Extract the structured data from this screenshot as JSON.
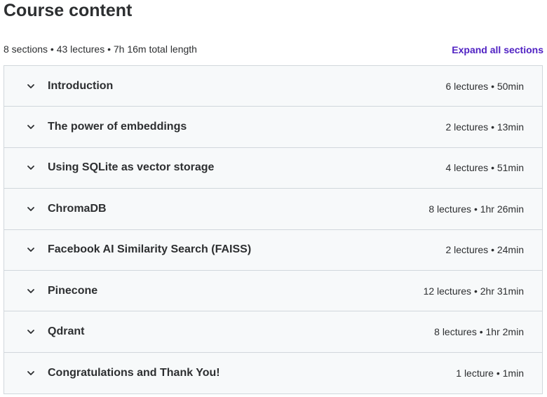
{
  "header": {
    "title": "Course content",
    "summary": "8 sections • 43 lectures • 7h 16m total length",
    "expand_all_label": "Expand all sections"
  },
  "icons": {
    "section_toggle": "chevron-down-icon"
  },
  "colors": {
    "accent": "#5022c3",
    "text": "#2d2f31",
    "section_bg": "#f7f9fa",
    "border": "#d1d7dc"
  },
  "sections": [
    {
      "title": "Introduction",
      "info": "6 lectures • 50min"
    },
    {
      "title": "The power of embeddings",
      "info": "2 lectures • 13min"
    },
    {
      "title": "Using SQLite as vector storage",
      "info": "4 lectures • 51min"
    },
    {
      "title": "ChromaDB",
      "info": "8 lectures • 1hr 26min"
    },
    {
      "title": "Facebook AI Similarity Search (FAISS)",
      "info": "2 lectures • 24min"
    },
    {
      "title": "Pinecone",
      "info": "12 lectures • 2hr 31min"
    },
    {
      "title": "Qdrant",
      "info": "8 lectures • 1hr 2min"
    },
    {
      "title": "Congratulations and Thank You!",
      "info": "1 lecture • 1min"
    }
  ]
}
